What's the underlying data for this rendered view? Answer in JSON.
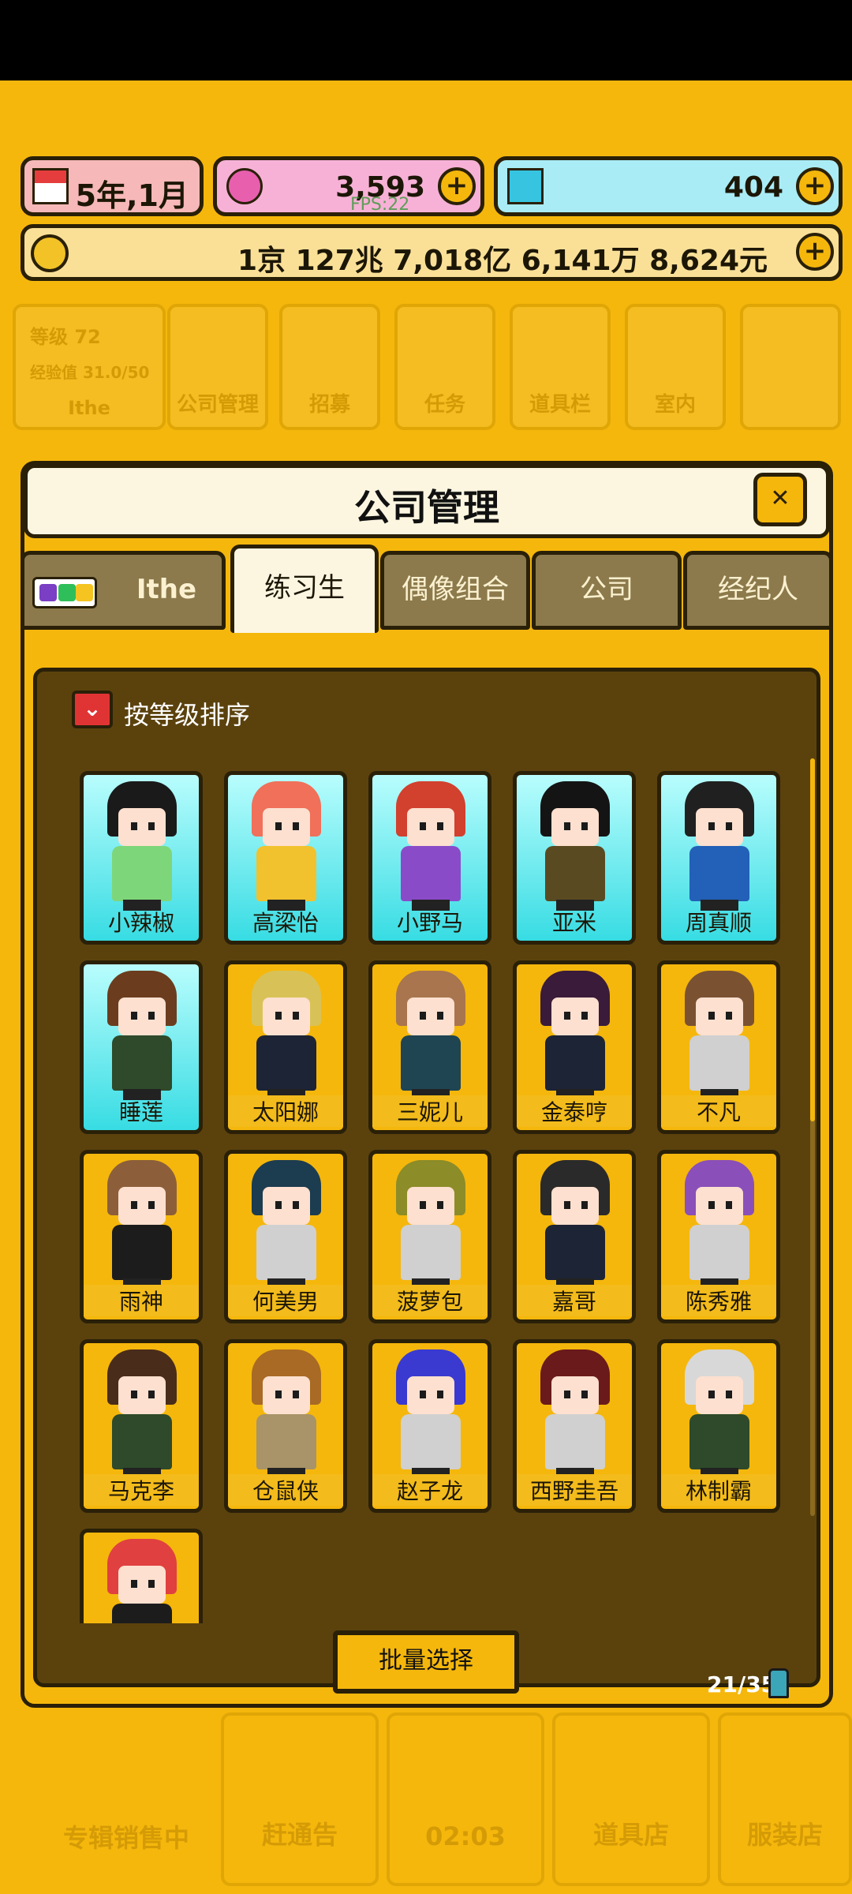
{
  "hud": {
    "date": "5年,1月",
    "gems": "3,593",
    "diamonds": "404",
    "money": "1京 127兆 7,018亿 6,141万 8,624元",
    "fps_overlay": "FPS:22"
  },
  "background_menu": {
    "profile": {
      "level_label": "等级",
      "level": "72",
      "exp_label": "经验值 31.0/50",
      "name": "Ithe"
    },
    "items": [
      "公司管理",
      "招募",
      "任务",
      "道具栏",
      "室内"
    ],
    "bottom": [
      "专辑销售中",
      "赶通告",
      "02:03",
      "道具店",
      "服装店"
    ]
  },
  "panel": {
    "title": "公司管理",
    "close_icon": "close-icon",
    "tabs": [
      {
        "label": "Ithe",
        "active": false
      },
      {
        "label": "练习生",
        "active": true
      },
      {
        "label": "偶像组合",
        "active": false
      },
      {
        "label": "公司",
        "active": false
      },
      {
        "label": "经纪人",
        "active": false
      }
    ],
    "sort_label": "按等级排序",
    "batch_select": "批量选择",
    "count": "21/35"
  },
  "trainees": [
    {
      "name": "小辣椒",
      "rarity": "cyan",
      "hair": "#1a1a1a",
      "outfit": "#7ed67a"
    },
    {
      "name": "高梁怡",
      "rarity": "cyan",
      "hair": "#f0705a",
      "outfit": "#f2c12e"
    },
    {
      "name": "小野马",
      "rarity": "cyan",
      "hair": "#d2402e",
      "outfit": "#8a4bc9"
    },
    {
      "name": "亚米",
      "rarity": "cyan",
      "hair": "#141414",
      "outfit": "#5a4a22"
    },
    {
      "name": "周真顺",
      "rarity": "cyan",
      "hair": "#202020",
      "outfit": "#2360b8"
    },
    {
      "name": "睡莲",
      "rarity": "cyan",
      "hair": "#6b3d1e",
      "outfit": "#2e4a2a"
    },
    {
      "name": "太阳娜",
      "rarity": "gold",
      "hair": "#d8c257",
      "outfit": "#1d2435"
    },
    {
      "name": "三妮儿",
      "rarity": "gold",
      "hair": "#a8754e",
      "outfit": "#1f4452"
    },
    {
      "name": "金泰哼",
      "rarity": "gold",
      "hair": "#3a1b3a",
      "outfit": "#1d2435"
    },
    {
      "name": "不凡",
      "rarity": "gold",
      "hair": "#7a5232",
      "outfit": "#d0d0d0"
    },
    {
      "name": "雨神",
      "rarity": "gold",
      "hair": "#8c5f3a",
      "outfit": "#1c1c1c"
    },
    {
      "name": "何美男",
      "rarity": "gold",
      "hair": "#1c3c50",
      "outfit": "#d0d0d0"
    },
    {
      "name": "菠萝包",
      "rarity": "gold",
      "hair": "#8c8c28",
      "outfit": "#d0d0d0"
    },
    {
      "name": "嘉哥",
      "rarity": "gold",
      "hair": "#2a2a2a",
      "outfit": "#1d2435"
    },
    {
      "name": "陈秀雅",
      "rarity": "gold",
      "hair": "#8a4fb8",
      "outfit": "#d0d0d0"
    },
    {
      "name": "马克李",
      "rarity": "gold",
      "hair": "#4a2c1a",
      "outfit": "#2e4a2a"
    },
    {
      "name": "仓鼠侠",
      "rarity": "gold",
      "hair": "#a86a24",
      "outfit": "#a89468"
    },
    {
      "name": "赵子龙",
      "rarity": "gold",
      "hair": "#3a3ad0",
      "outfit": "#d0d0d0"
    },
    {
      "name": "西野圭吾",
      "rarity": "gold",
      "hair": "#6a1a1a",
      "outfit": "#d0d0d0"
    },
    {
      "name": "林制霸",
      "rarity": "gold",
      "hair": "#d8d8d8",
      "outfit": "#2e4a2a"
    },
    {
      "name": "",
      "rarity": "gold",
      "hair": "#e04040",
      "outfit": "#1c1c1c",
      "partial": true
    }
  ]
}
